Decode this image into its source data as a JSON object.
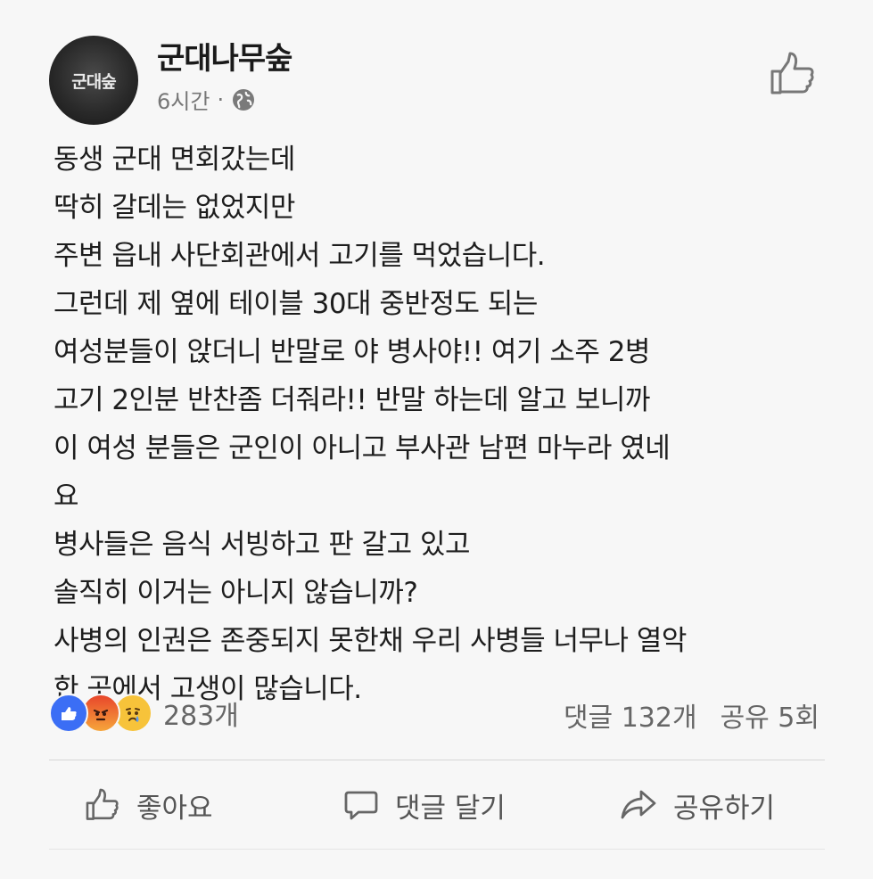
{
  "post": {
    "avatar_text": "군대숲",
    "page_name": "군대나무숲",
    "time": "6시간",
    "separator": "·",
    "privacy_icon": "globe-icon",
    "top_action_icon": "like-icon",
    "lines": [
      "동생 군대 면회갔는데",
      "딱히 갈데는 없었지만",
      "주변 읍내 사단회관에서 고기를 먹었습니다.",
      "그런데 제 옆에 테이블 30대 중반정도 되는",
      "여성분들이 앉더니 반말로 야 병사야!! 여기 소주 2병",
      "고기 2인분 반찬좀 더줘라!! 반말 하는데 알고 보니까",
      "이 여성 분들은 군인이 아니고 부사관 남편 마누라 였네",
      "요",
      "병사들은 음식 서빙하고 판 갈고 있고",
      "솔직히 이거는 아니지 않습니까?",
      "사병의 인권은 존중되지 못한채 우리 사병들 너무나 열악",
      "한 곳에서 고생이 많습니다."
    ]
  },
  "reactions": {
    "icons": [
      "like-icon",
      "angry-icon",
      "sad-icon"
    ],
    "count": "283개"
  },
  "stats": {
    "comments": "댓글 132개",
    "shares": "공유 5회"
  },
  "actions": {
    "like_label": "좋아요",
    "comment_label": "댓글 달기",
    "share_label": "공유하기"
  },
  "colors": {
    "background": "#f7f7f7",
    "like_blue": "#3b6ef5",
    "text": "#1d1d1d",
    "muted": "#666666"
  }
}
